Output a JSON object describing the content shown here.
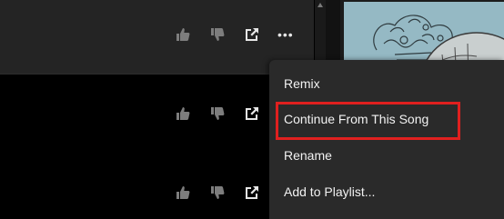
{
  "rows": [
    {
      "like_icon": "thumbs-up-icon",
      "dislike_icon": "thumbs-down-icon",
      "share_icon": "share-icon",
      "more": "•••"
    },
    {
      "like_icon": "thumbs-up-icon",
      "dislike_icon": "thumbs-down-icon",
      "share_icon": "share-icon"
    },
    {
      "like_icon": "thumbs-up-icon",
      "dislike_icon": "thumbs-down-icon",
      "share_icon": "share-icon"
    }
  ],
  "context_menu": {
    "items": [
      "Remix",
      "Continue From This Song",
      "Rename",
      "Add to Playlist..."
    ],
    "highlighted_item": "Continue From This Song",
    "highlight_color": "#e0201f"
  },
  "colors": {
    "background": "#000000",
    "selected_row": "#242424",
    "menu_bg": "#2a2a2a",
    "icon_dim": "#7d7d7d",
    "icon_bright": "#e6e6e6"
  }
}
